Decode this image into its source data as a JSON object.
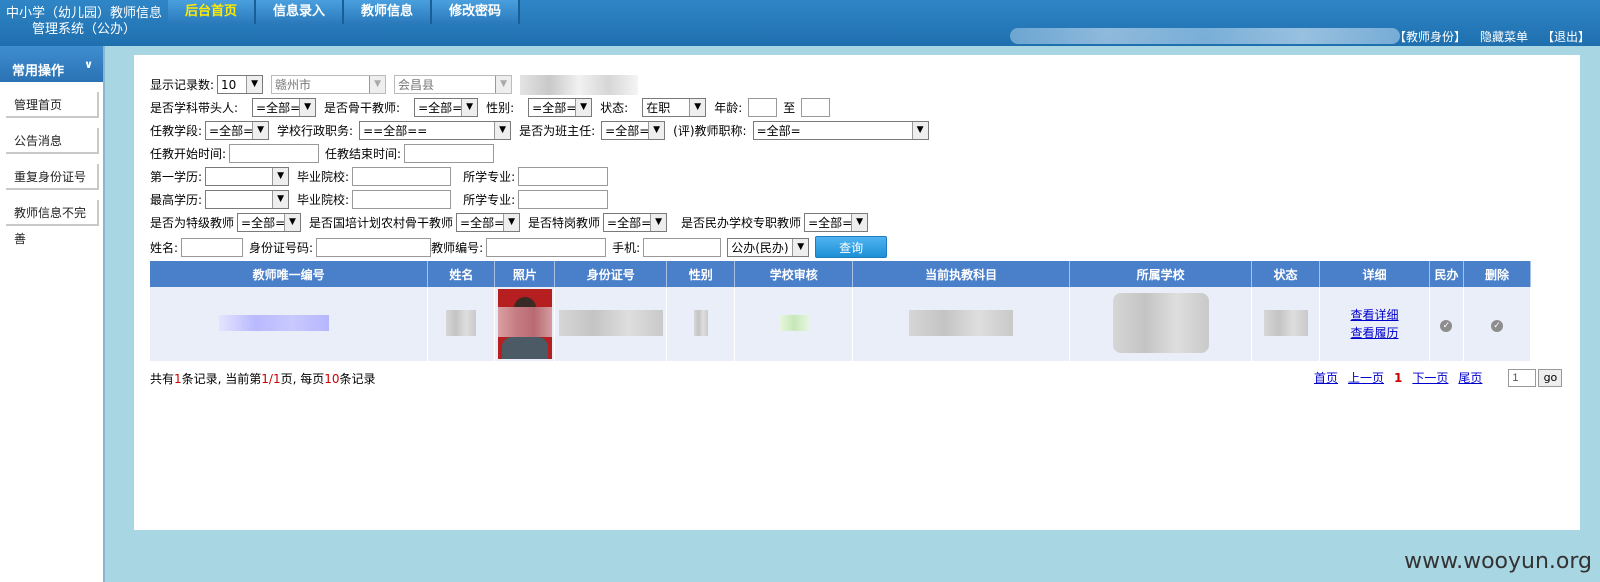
{
  "header": {
    "logo_line1": "中小学（幼儿园）教师信息",
    "logo_line2": "管理系统（公办）",
    "tabs": [
      "后台首页",
      "信息录入",
      "教师信息",
      "修改密码"
    ],
    "links": [
      "【教师身份】",
      "隐藏菜单",
      "【退出】"
    ]
  },
  "sidebar": {
    "title": "常用操作",
    "items": [
      "管理首页",
      "公告消息",
      "重复身份证号",
      "教师信息不完善"
    ]
  },
  "filters": {
    "show_count_label": "显示记录数:",
    "show_count_value": "10",
    "city": "赣州市",
    "county": "会昌县",
    "leader_label": "是否学科带头人:",
    "all": "=全部=",
    "all2": "==全部==",
    "backbone_label": "是否骨干教师:",
    "gender_label": "性别:",
    "status_label": "状态:",
    "status_value": "在职",
    "age_label": "年龄:",
    "to_label": "至",
    "stage_label": "任教学段:",
    "admin_label": "学校行政职务:",
    "headteacher_label": "是否为班主任:",
    "title_label": "(评)教师职称:",
    "start_label": "任教开始时间:",
    "end_label": "任教结束时间:",
    "first_edu_label": "第一学历:",
    "school_label": "毕业院校:",
    "major_label": "所学专业:",
    "top_edu_label": "最高学历:",
    "special_label": "是否为特级教师",
    "rural_label": "是否国培计划农村骨干教师",
    "post_label": "是否特岗教师",
    "private_label": "是否民办学校专职教师",
    "name_label": "姓名:",
    "id_label": "身份证号码:",
    "teacher_no_label": "教师编号:",
    "phone_label": "手机:",
    "type_value": "公办(民办)",
    "query_button": "查询"
  },
  "table": {
    "columns": [
      "教师唯一编号",
      "姓名",
      "照片",
      "身份证号",
      "性别",
      "学校审核",
      "当前执教科目",
      "所属学校",
      "状态",
      "详细",
      "民办",
      "删除"
    ],
    "row": {
      "detail_link": "查看详细",
      "history_link": "查看履历"
    }
  },
  "summary": {
    "t1": "共有",
    "total": "1",
    "t2": "条记录, 当前第",
    "page": "1/1",
    "t3": "页, 每页",
    "per_page": "10",
    "t4": "条记录"
  },
  "pager": {
    "first": "首页",
    "prev": "上一页",
    "current": "1",
    "next": "下一页",
    "last": "尾页",
    "input": "1",
    "go": "go"
  },
  "watermark": "www.wooyun.org"
}
